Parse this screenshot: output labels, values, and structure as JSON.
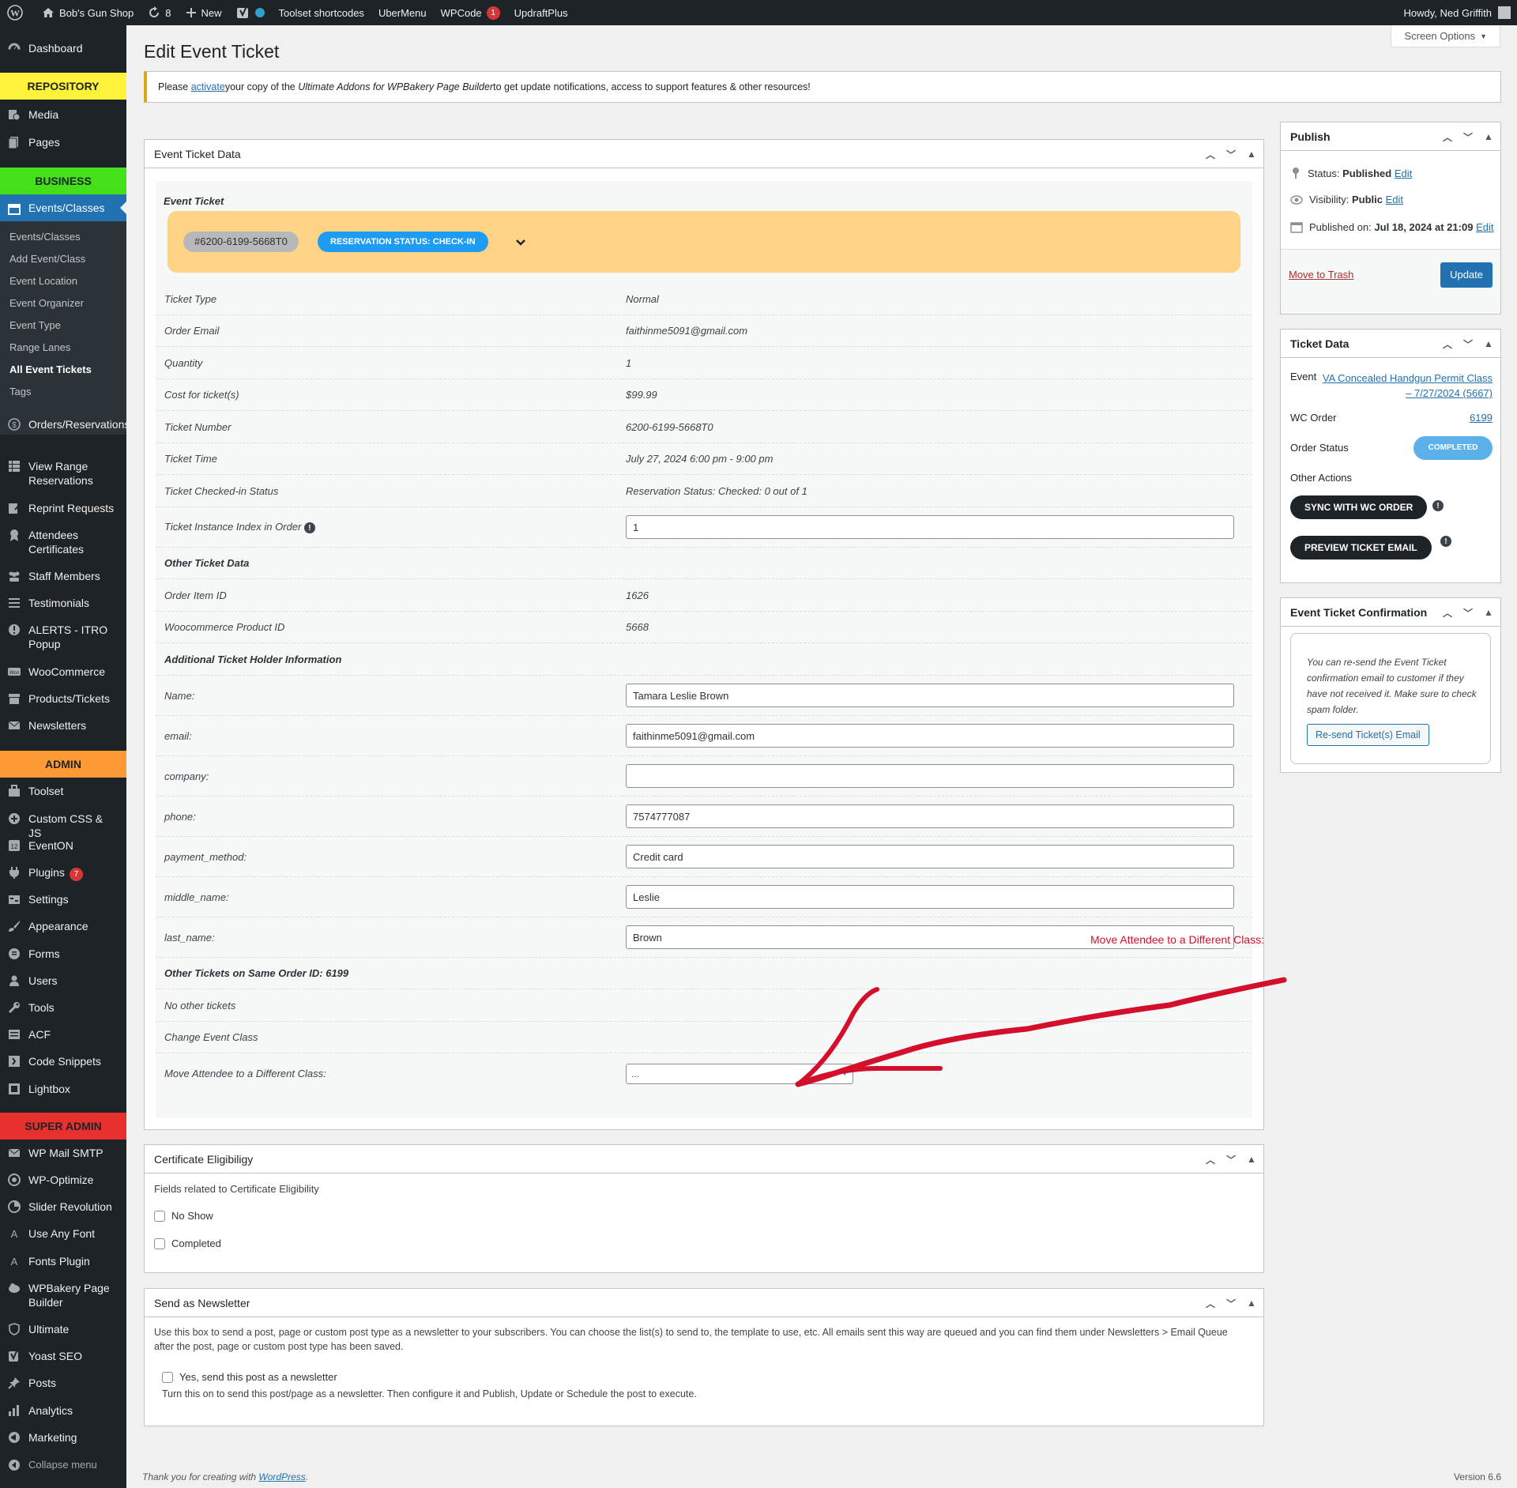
{
  "adminbar": {
    "site_name": "Bob's Gun Shop",
    "updates_count": "8",
    "new_label": "New",
    "toolset_shortcodes": "Toolset shortcodes",
    "ubermenu": "UberMenu",
    "wpcode": "WPCode",
    "wpcode_badge": "1",
    "updraftplus": "UpdraftPlus",
    "howdy": "Howdy, Ned Griffith"
  },
  "sidebar": {
    "dashboard": "Dashboard",
    "sec_repository": "REPOSITORY",
    "media": "Media",
    "pages": "Pages",
    "sec_business": "BUSINESS",
    "events_classes": "Events/Classes",
    "sub": [
      "Events/Classes",
      "Add Event/Class",
      "Event Location",
      "Event Organizer",
      "Event Type",
      "Range Lanes",
      "All Event Tickets",
      "Tags"
    ],
    "orders": "Orders/Reservations",
    "view_range": "View Range Reservations",
    "reprint": "Reprint Requests",
    "attendees": "Attendees Certificates",
    "staff": "Staff Members",
    "testimonials": "Testimonials",
    "alerts": "ALERTS - ITRO Popup",
    "woocommerce": "WooCommerce",
    "products": "Products/Tickets",
    "newsletters": "Newsletters",
    "sec_admin": "ADMIN",
    "toolset": "Toolset",
    "custom_css": "Custom CSS & JS",
    "eventon": "EventON",
    "plugins": "Plugins",
    "plugins_badge": "7",
    "settings": "Settings",
    "appearance": "Appearance",
    "forms": "Forms",
    "users": "Users",
    "tools": "Tools",
    "acf": "ACF",
    "code_snippets": "Code Snippets",
    "lightbox": "Lightbox",
    "sec_super": "SUPER ADMIN",
    "wp_mail": "WP Mail SMTP",
    "wp_optimize": "WP-Optimize",
    "slider": "Slider Revolution",
    "use_any_font": "Use Any Font",
    "fonts_plugin": "Fonts Plugin",
    "wpbakery": "WPBakery Page Builder",
    "ultimate": "Ultimate",
    "yoast": "Yoast SEO",
    "posts": "Posts",
    "analytics": "Analytics",
    "marketing": "Marketing",
    "collapse": "Collapse menu"
  },
  "page": {
    "title": "Edit Event Ticket",
    "screen_options": "Screen Options",
    "notice_pre": "Please ",
    "notice_link": "activate",
    "notice_mid": " your copy of the ",
    "notice_em": "Ultimate Addons for WPBakery Page Builder",
    "notice_post": " to get update notifications, access to support features & other resources!"
  },
  "etd": {
    "box_title": "Event Ticket Data",
    "section_label": "Event Ticket",
    "ticket_id_pill": "#6200-6199-5668T0",
    "status_pill": "RESERVATION STATUS: CHECK-IN",
    "rows": [
      {
        "k": "Ticket Type",
        "v": "Normal"
      },
      {
        "k": "Order Email",
        "v": "faithinme5091@gmail.com"
      },
      {
        "k": "Quantity",
        "v": "1"
      },
      {
        "k": "Cost for ticket(s)",
        "v": "$99.99"
      },
      {
        "k": "Ticket Number",
        "v": "6200-6199-5668T0"
      },
      {
        "k": "Ticket Time",
        "v": "July 27, 2024 6:00 pm - 9:00 pm"
      },
      {
        "k": "Ticket Checked-in Status",
        "v": "Reservation Status: Checked: 0 out of 1"
      }
    ],
    "instance_label": "Ticket Instance Index in Order",
    "instance_value": "1",
    "other_data_head": "Other Ticket Data",
    "order_item_label": "Order Item ID",
    "order_item_value": "1626",
    "product_id_label": "Woocommerce Product ID",
    "product_id_value": "5668",
    "additional_head": "Additional Ticket Holder Information",
    "holder": [
      {
        "k": "Name:",
        "v": "Tamara  Leslie Brown"
      },
      {
        "k": "email:",
        "v": "faithinme5091@gmail.com"
      },
      {
        "k": "company:",
        "v": ""
      },
      {
        "k": "phone:",
        "v": "7574777087"
      },
      {
        "k": "payment_method:",
        "v": "Credit card"
      },
      {
        "k": "middle_name:",
        "v": "Leslie"
      },
      {
        "k": "last_name:",
        "v": "Brown"
      }
    ],
    "other_tickets_head": "Other Tickets on Same Order ID: 6199",
    "no_other": "No other tickets",
    "change_class": "Change Event Class",
    "move_label": "Move Attendee to a Different Class:",
    "move_select": "...",
    "annotation": "Move Attendee to a Different Class:"
  },
  "cert": {
    "title": "Certificate Eligibiligy",
    "desc": "Fields related to Certificate Eligibility",
    "no_show": "No Show",
    "completed": "Completed"
  },
  "newsletter": {
    "title": "Send as Newsletter",
    "desc": "Use this box to send a post, page or custom post type as a newsletter to your subscribers. You can choose the list(s) to send to, the template to use, etc. All emails sent this way are queued and you can find them under Newsletters > Email Queue after the post, page or custom post type has been saved.",
    "checkbox": "Yes, send this post as a newsletter",
    "help": "Turn this on to send this post/page as a newsletter. Then configure it and Publish, Update or Schedule the post to execute."
  },
  "publish": {
    "title": "Publish",
    "status_label": "Status: ",
    "status_value": "Published",
    "visibility_label": "Visibility: ",
    "visibility_value": "Public",
    "published_label": "Published on: ",
    "published_value": "Jul 18, 2024 at 21:09",
    "edit": "Edit",
    "trash": "Move to Trash",
    "update": "Update"
  },
  "ticket_data": {
    "title": "Ticket Data",
    "event_label": "Event",
    "event_link_1": "VA Concealed Handgun Permit Class",
    "event_link_2": "– 7/27/2024 (5667)",
    "wc_order_label": "WC Order",
    "wc_order_value": "6199",
    "order_status_label": "Order Status",
    "order_status_value": "COMPLETED",
    "other_actions": "Other Actions",
    "sync_btn": "SYNC WITH WC ORDER",
    "preview_btn": "PREVIEW TICKET EMAIL"
  },
  "confirmation": {
    "title": "Event Ticket Confirmation",
    "text": "You can re-send the Event Ticket confirmation email to customer if they have not received it. Make sure to check spam folder.",
    "button": "Re-send Ticket(s) Email"
  },
  "footer": {
    "thanks_pre": "Thank you for creating with ",
    "thanks_link": "WordPress",
    "version": "Version 6.6"
  },
  "colors": {
    "repository_bg": "#fff23b",
    "business_bg": "#44e01a",
    "admin_bg": "#fd9a33",
    "super_admin_bg": "#e8302f",
    "ticket_card_bg": "#fdd485",
    "status_pill_bg": "#1e9cf4",
    "completed_bg": "#5bb1e8",
    "annotation_red": "#d40f2b"
  }
}
